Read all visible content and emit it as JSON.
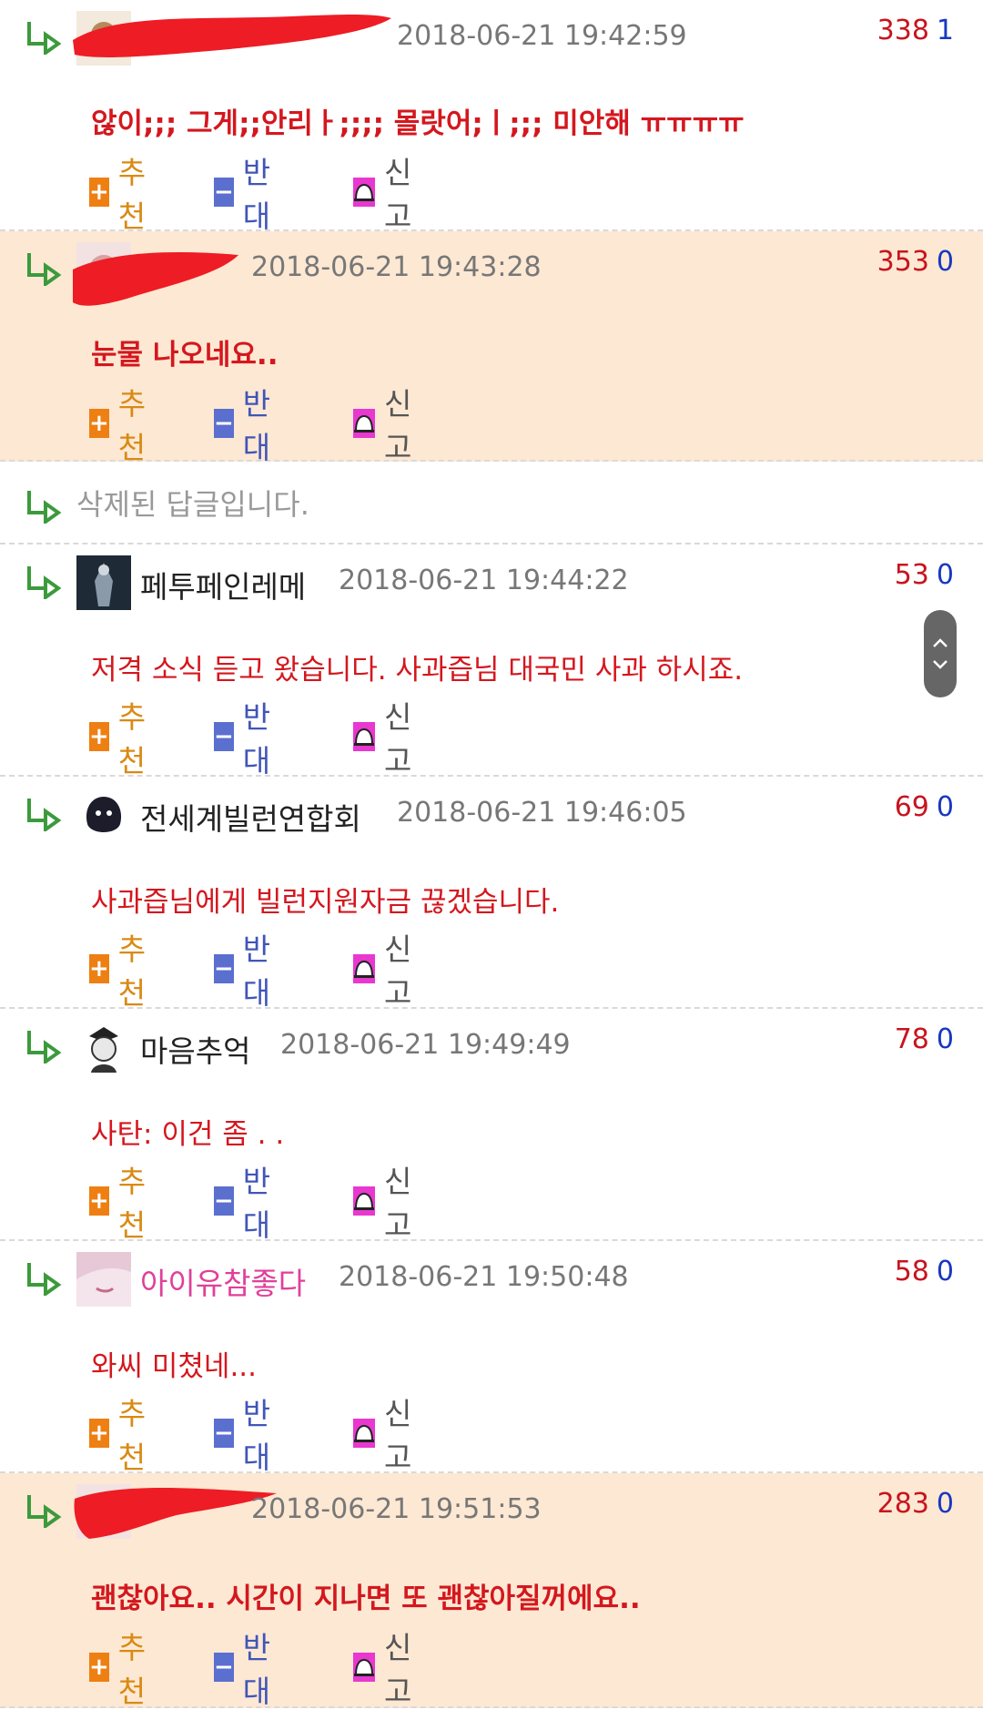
{
  "comments": [
    {
      "nick": "",
      "time": "2018-06-21 19:42:59",
      "up": "338",
      "down": "1",
      "text": "않이;;; 그게;;안리ㅏ;;;; 몰랏어;ㅣ;;; 미안해 ㅠㅠㅠㅠ"
    },
    {
      "nick": "",
      "time": "2018-06-21 19:43:28",
      "up": "353",
      "down": "0",
      "text": "눈물 나오네요.."
    },
    {
      "deleted_text": "삭제된 답글입니다."
    },
    {
      "nick": "페투페인레메",
      "time": "2018-06-21 19:44:22",
      "up": "53",
      "down": "0",
      "text": "저격 소식 듣고 왔습니다. 사과즙님 대국민 사과 하시죠."
    },
    {
      "nick": "전세계빌런연합회",
      "time": "2018-06-21 19:46:05",
      "up": "69",
      "down": "0",
      "text": "사과즙님에게 빌런지원자금 끊겠습니다."
    },
    {
      "nick": "마음추억",
      "time": "2018-06-21 19:49:49",
      "up": "78",
      "down": "0",
      "text": "사탄: 이건 좀 . ."
    },
    {
      "nick": "아이유참좋다",
      "time": "2018-06-21 19:50:48",
      "up": "58",
      "down": "0",
      "text": "와씨 미쳤네..."
    },
    {
      "nick": "",
      "time": "2018-06-21 19:51:53",
      "up": "283",
      "down": "0",
      "text": "괜찮아요.. 시간이 지나면 또 괜찮아질꺼에요.."
    }
  ],
  "actions": {
    "recommend": "추천",
    "oppose": "반대",
    "report": "신고",
    "plus_symbol": "+",
    "minus_symbol": "−"
  },
  "colors": {
    "highlight_bg": "#fde8d3",
    "text_red": "#d4171e",
    "count_red": "#c8141e",
    "count_blue": "#1838c0",
    "recommend_orange": "#ee7f12",
    "oppose_blue": "#5b6fcf",
    "report_magenta": "#e838d0",
    "redaction": "#ee1c24"
  },
  "icons": {
    "reply": "reply-arrow-icon",
    "scroll_up": "chevron-up-icon",
    "scroll_down": "chevron-down-icon",
    "report": "bell-icon"
  }
}
